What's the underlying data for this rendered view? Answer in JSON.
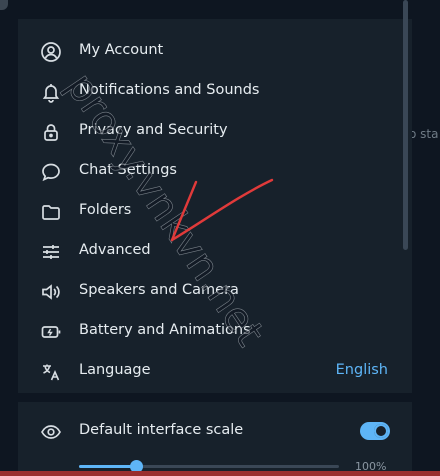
{
  "menu": {
    "items": [
      {
        "label": "My Account",
        "icon": "user-circle-icon"
      },
      {
        "label": "Notifications and Sounds",
        "icon": "bell-icon"
      },
      {
        "label": "Privacy and Security",
        "icon": "lock-icon"
      },
      {
        "label": "Chat Settings",
        "icon": "chat-bubble-icon"
      },
      {
        "label": "Folders",
        "icon": "folder-icon"
      },
      {
        "label": "Advanced",
        "icon": "sliders-icon"
      },
      {
        "label": "Speakers and Camera",
        "icon": "speaker-icon"
      },
      {
        "label": "Battery and Animations",
        "icon": "battery-icon"
      },
      {
        "label": "Language",
        "icon": "translate-icon",
        "value": "English"
      }
    ]
  },
  "scale": {
    "label": "Default interface scale",
    "icon": "eye-icon",
    "toggle_on": true,
    "slider_fraction": 0.22,
    "value_label": "100%"
  },
  "background": {
    "peek_text": "o sta"
  },
  "watermark": {
    "text": "proxy.vnkvn.net"
  },
  "colors": {
    "panel_bg": "#17212b",
    "outer_bg": "#0e1621",
    "accent": "#5eb5f7",
    "text": "#e6ecf0",
    "icon": "#d7dde2",
    "annotation": "#e03a3a"
  }
}
